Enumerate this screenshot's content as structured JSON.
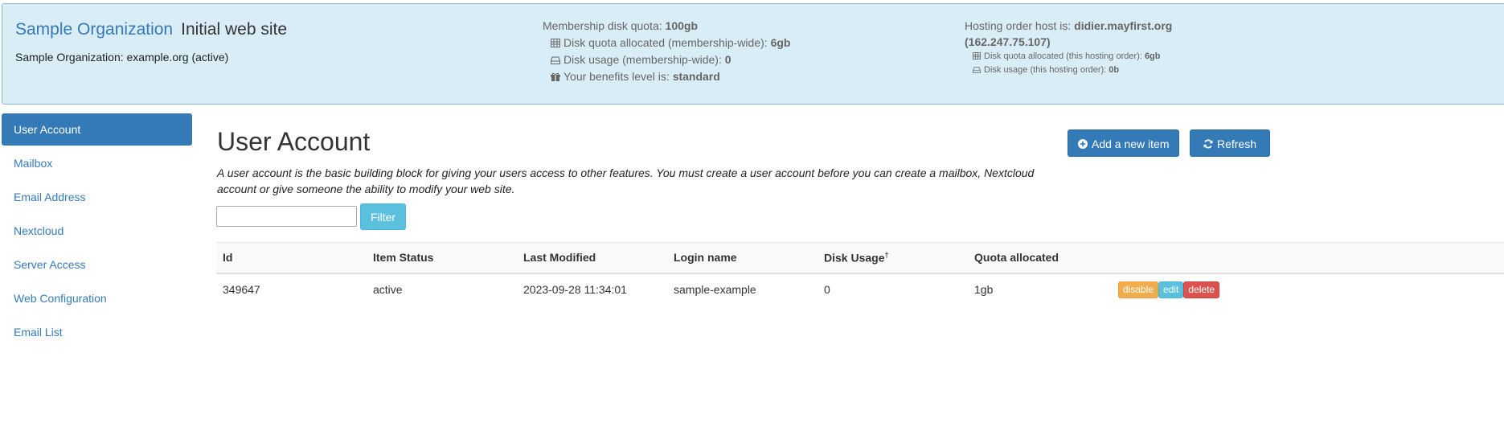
{
  "header": {
    "org_name": "Sample Organization",
    "site_name": "Initial web site",
    "org_status": "Sample Organization: example.org (active)",
    "membership": {
      "quota_label": "Membership disk quota: ",
      "quota_value": "100gb",
      "allocated_label": "Disk quota allocated (membership-wide): ",
      "allocated_value": "6gb",
      "usage_label": "Disk usage (membership-wide): ",
      "usage_value": "0",
      "benefits_label": "Your benefits level is: ",
      "benefits_value": "standard"
    },
    "hosting": {
      "host_label": "Hosting order host is: ",
      "host_value": "didier.mayfirst.org",
      "host_ip": "(162.247.75.107)",
      "allocated_label": "Disk quota allocated (this hosting order): ",
      "allocated_value": "6gb",
      "usage_label": "Disk usage (this hosting order): ",
      "usage_value": "0b"
    }
  },
  "sidebar": {
    "items": [
      {
        "label": "User Account"
      },
      {
        "label": "Mailbox"
      },
      {
        "label": "Email Address"
      },
      {
        "label": "Nextcloud"
      },
      {
        "label": "Server Access"
      },
      {
        "label": "Web Configuration"
      },
      {
        "label": "Email List"
      }
    ]
  },
  "main": {
    "title": "User Account",
    "description": "A user account is the basic building block for giving your users access to other features. You must create a user account before you can create a mailbox, Nextcloud account or give someone the ability to modify your web site.",
    "add_label": "Add a new item",
    "refresh_label": "Refresh",
    "filter_value": "",
    "filter_label": "Filter",
    "table": {
      "headers": [
        "Id",
        "Item Status",
        "Last Modified",
        "Login name",
        "Disk Usage",
        "Quota allocated"
      ],
      "disk_usage_mark": "†",
      "rows": [
        {
          "id": "349647",
          "status": "active",
          "modified": "2023-09-28 11:34:01",
          "login": "sample-example",
          "usage": "0",
          "quota": "1gb"
        }
      ],
      "actions": {
        "disable": "disable",
        "edit": "edit",
        "delete": "delete"
      }
    }
  },
  "colors": {
    "primary": "#337ab7",
    "header_bg": "#d9edf7",
    "info": "#5bc0de",
    "warning": "#f0ad4e",
    "danger": "#d9534f"
  },
  "icons": [
    "table-icon",
    "hdd-icon",
    "gift-icon",
    "plus-circle-icon",
    "refresh-icon"
  ]
}
